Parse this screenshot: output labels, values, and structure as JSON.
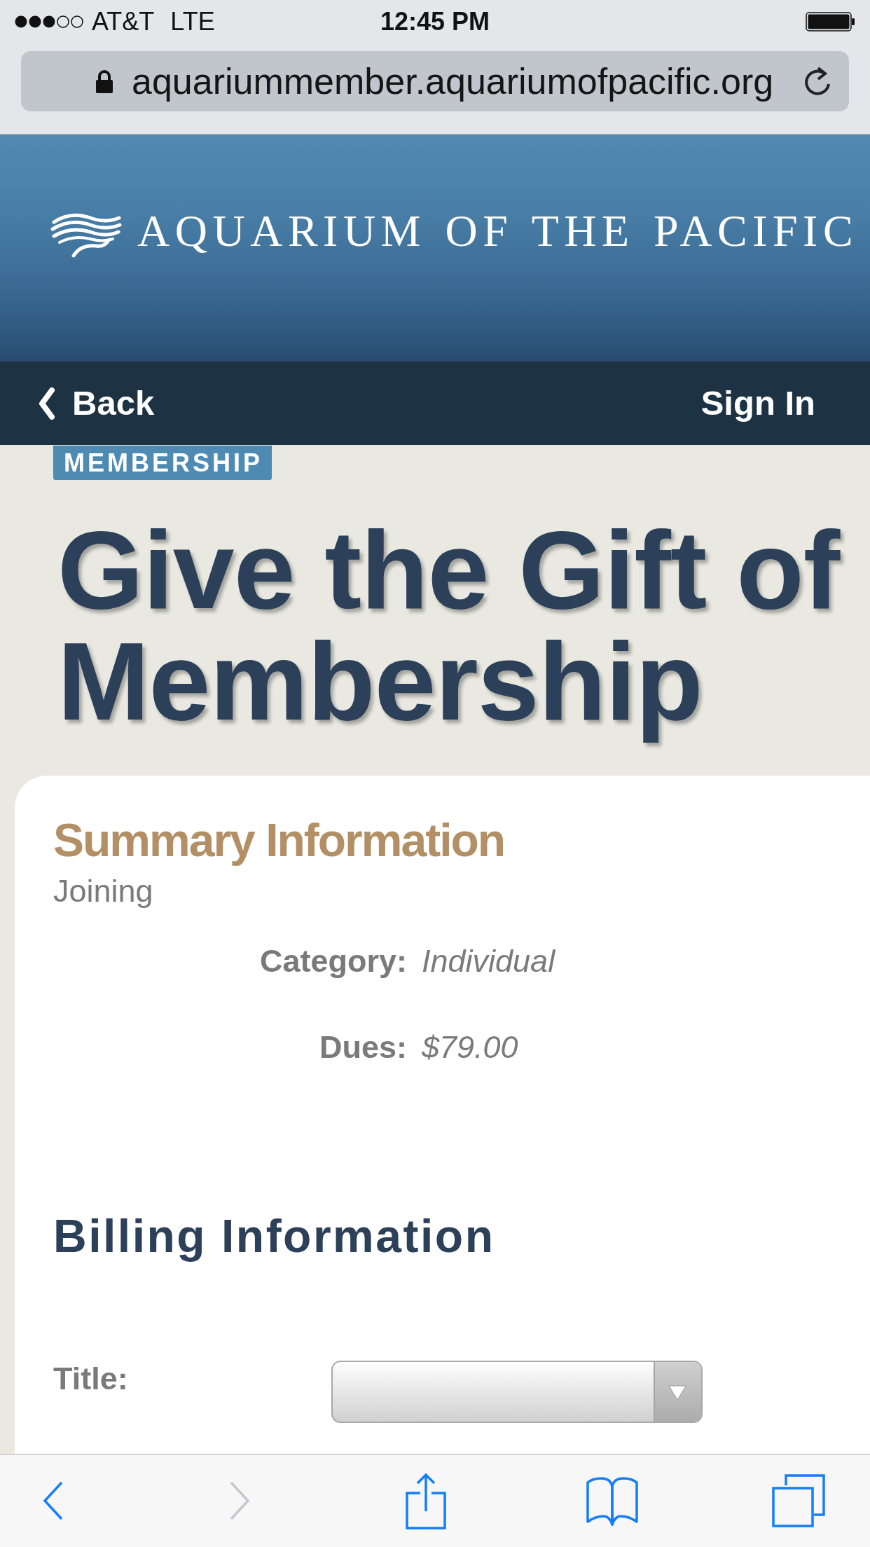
{
  "status_bar": {
    "carrier": "AT&T",
    "network": "LTE",
    "time": "12:45 PM"
  },
  "address_bar": {
    "url": "aquariummember.aquariumofpacific.org"
  },
  "banner": {
    "logo_text": "AQUARIUM OF THE PACIFIC"
  },
  "nav": {
    "back": "Back",
    "sign_in": "Sign In"
  },
  "section_label": "MEMBERSHIP",
  "heading": "Give the Gift of Membership",
  "summary": {
    "title": "Summary Information",
    "subtitle": "Joining",
    "fields": [
      {
        "label": "Category:",
        "value": "Individual"
      },
      {
        "label": "Dues:",
        "value": "$79.00"
      }
    ]
  },
  "billing": {
    "title": "Billing Information",
    "fields": [
      {
        "label": "Title:"
      }
    ]
  },
  "toolbar": {
    "buttons": [
      {
        "kind": "back",
        "disabled": false
      },
      {
        "kind": "forward",
        "disabled": true
      },
      {
        "kind": "share",
        "disabled": false
      },
      {
        "kind": "bookmarks",
        "disabled": false
      },
      {
        "kind": "tabs",
        "disabled": false
      }
    ]
  }
}
